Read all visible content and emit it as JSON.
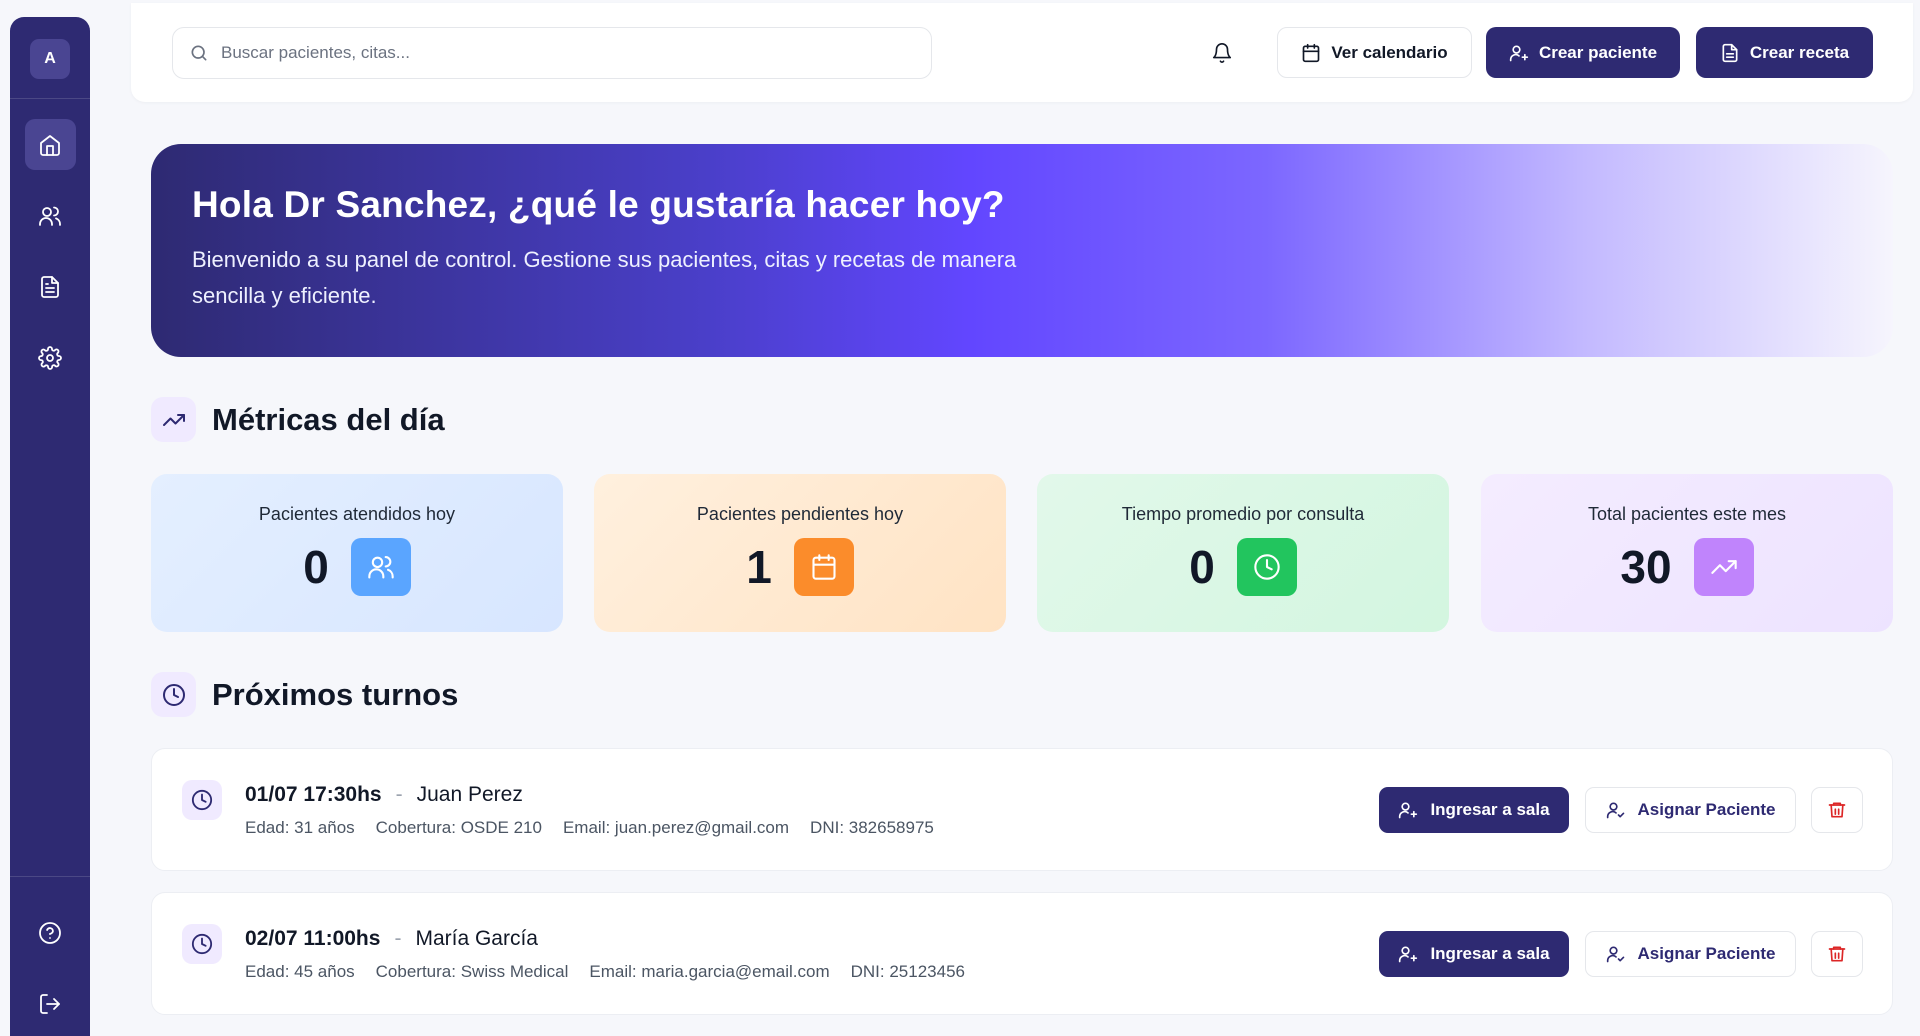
{
  "sidebar": {
    "logo_letter": "A",
    "items": [
      {
        "name": "home",
        "icon": "home-icon",
        "active": true
      },
      {
        "name": "patients",
        "icon": "users-icon",
        "active": false
      },
      {
        "name": "prescriptions",
        "icon": "document-icon",
        "active": false
      },
      {
        "name": "settings",
        "icon": "gear-icon",
        "active": false
      }
    ],
    "bottom": [
      {
        "name": "help",
        "icon": "help-circle-icon"
      },
      {
        "name": "logout",
        "icon": "logout-icon"
      }
    ]
  },
  "topbar": {
    "search_placeholder": "Buscar pacientes, citas...",
    "calendar_label": "Ver calendario",
    "create_patient_label": "Crear paciente",
    "create_prescription_label": "Crear receta"
  },
  "hero": {
    "title": "Hola Dr Sanchez, ¿qué le gustaría hacer hoy?",
    "subtitle": "Bienvenido a su panel de control. Gestione sus pacientes, citas y recetas de manera sencilla y eficiente."
  },
  "metrics": {
    "title": "Métricas del día",
    "cards": [
      {
        "label": "Pacientes atendidos hoy",
        "value": "0",
        "icon": "users-icon",
        "color": "#5aa5ff"
      },
      {
        "label": "Pacientes pendientes hoy",
        "value": "1",
        "icon": "calendar-icon",
        "color": "#fb8c2b"
      },
      {
        "label": "Tiempo promedio por consulta",
        "value": "0",
        "icon": "clock-icon",
        "color": "#22c55e"
      },
      {
        "label": "Total pacientes este mes",
        "value": "30",
        "icon": "trending-up-icon",
        "color": "#c084fc"
      }
    ]
  },
  "appointments": {
    "title": "Próximos turnos",
    "enter_room_label": "Ingresar a sala",
    "assign_label": "Asignar Paciente",
    "items": [
      {
        "datetime": "01/07 17:30hs",
        "name": "Juan Perez",
        "age": "Edad: 31 años",
        "coverage": "Cobertura: OSDE 210",
        "email": "Email: juan.perez@gmail.com",
        "dni": "DNI: 382658975"
      },
      {
        "datetime": "02/07 11:00hs",
        "name": "María García",
        "age": "Edad: 45 años",
        "coverage": "Cobertura: Swiss Medical",
        "email": "Email: maria.garcia@email.com",
        "dni": "DNI: 25123456"
      }
    ]
  },
  "colors": {
    "primary": "#2e2a72",
    "hero_violet": "#6246ff",
    "danger": "#dc2626"
  }
}
